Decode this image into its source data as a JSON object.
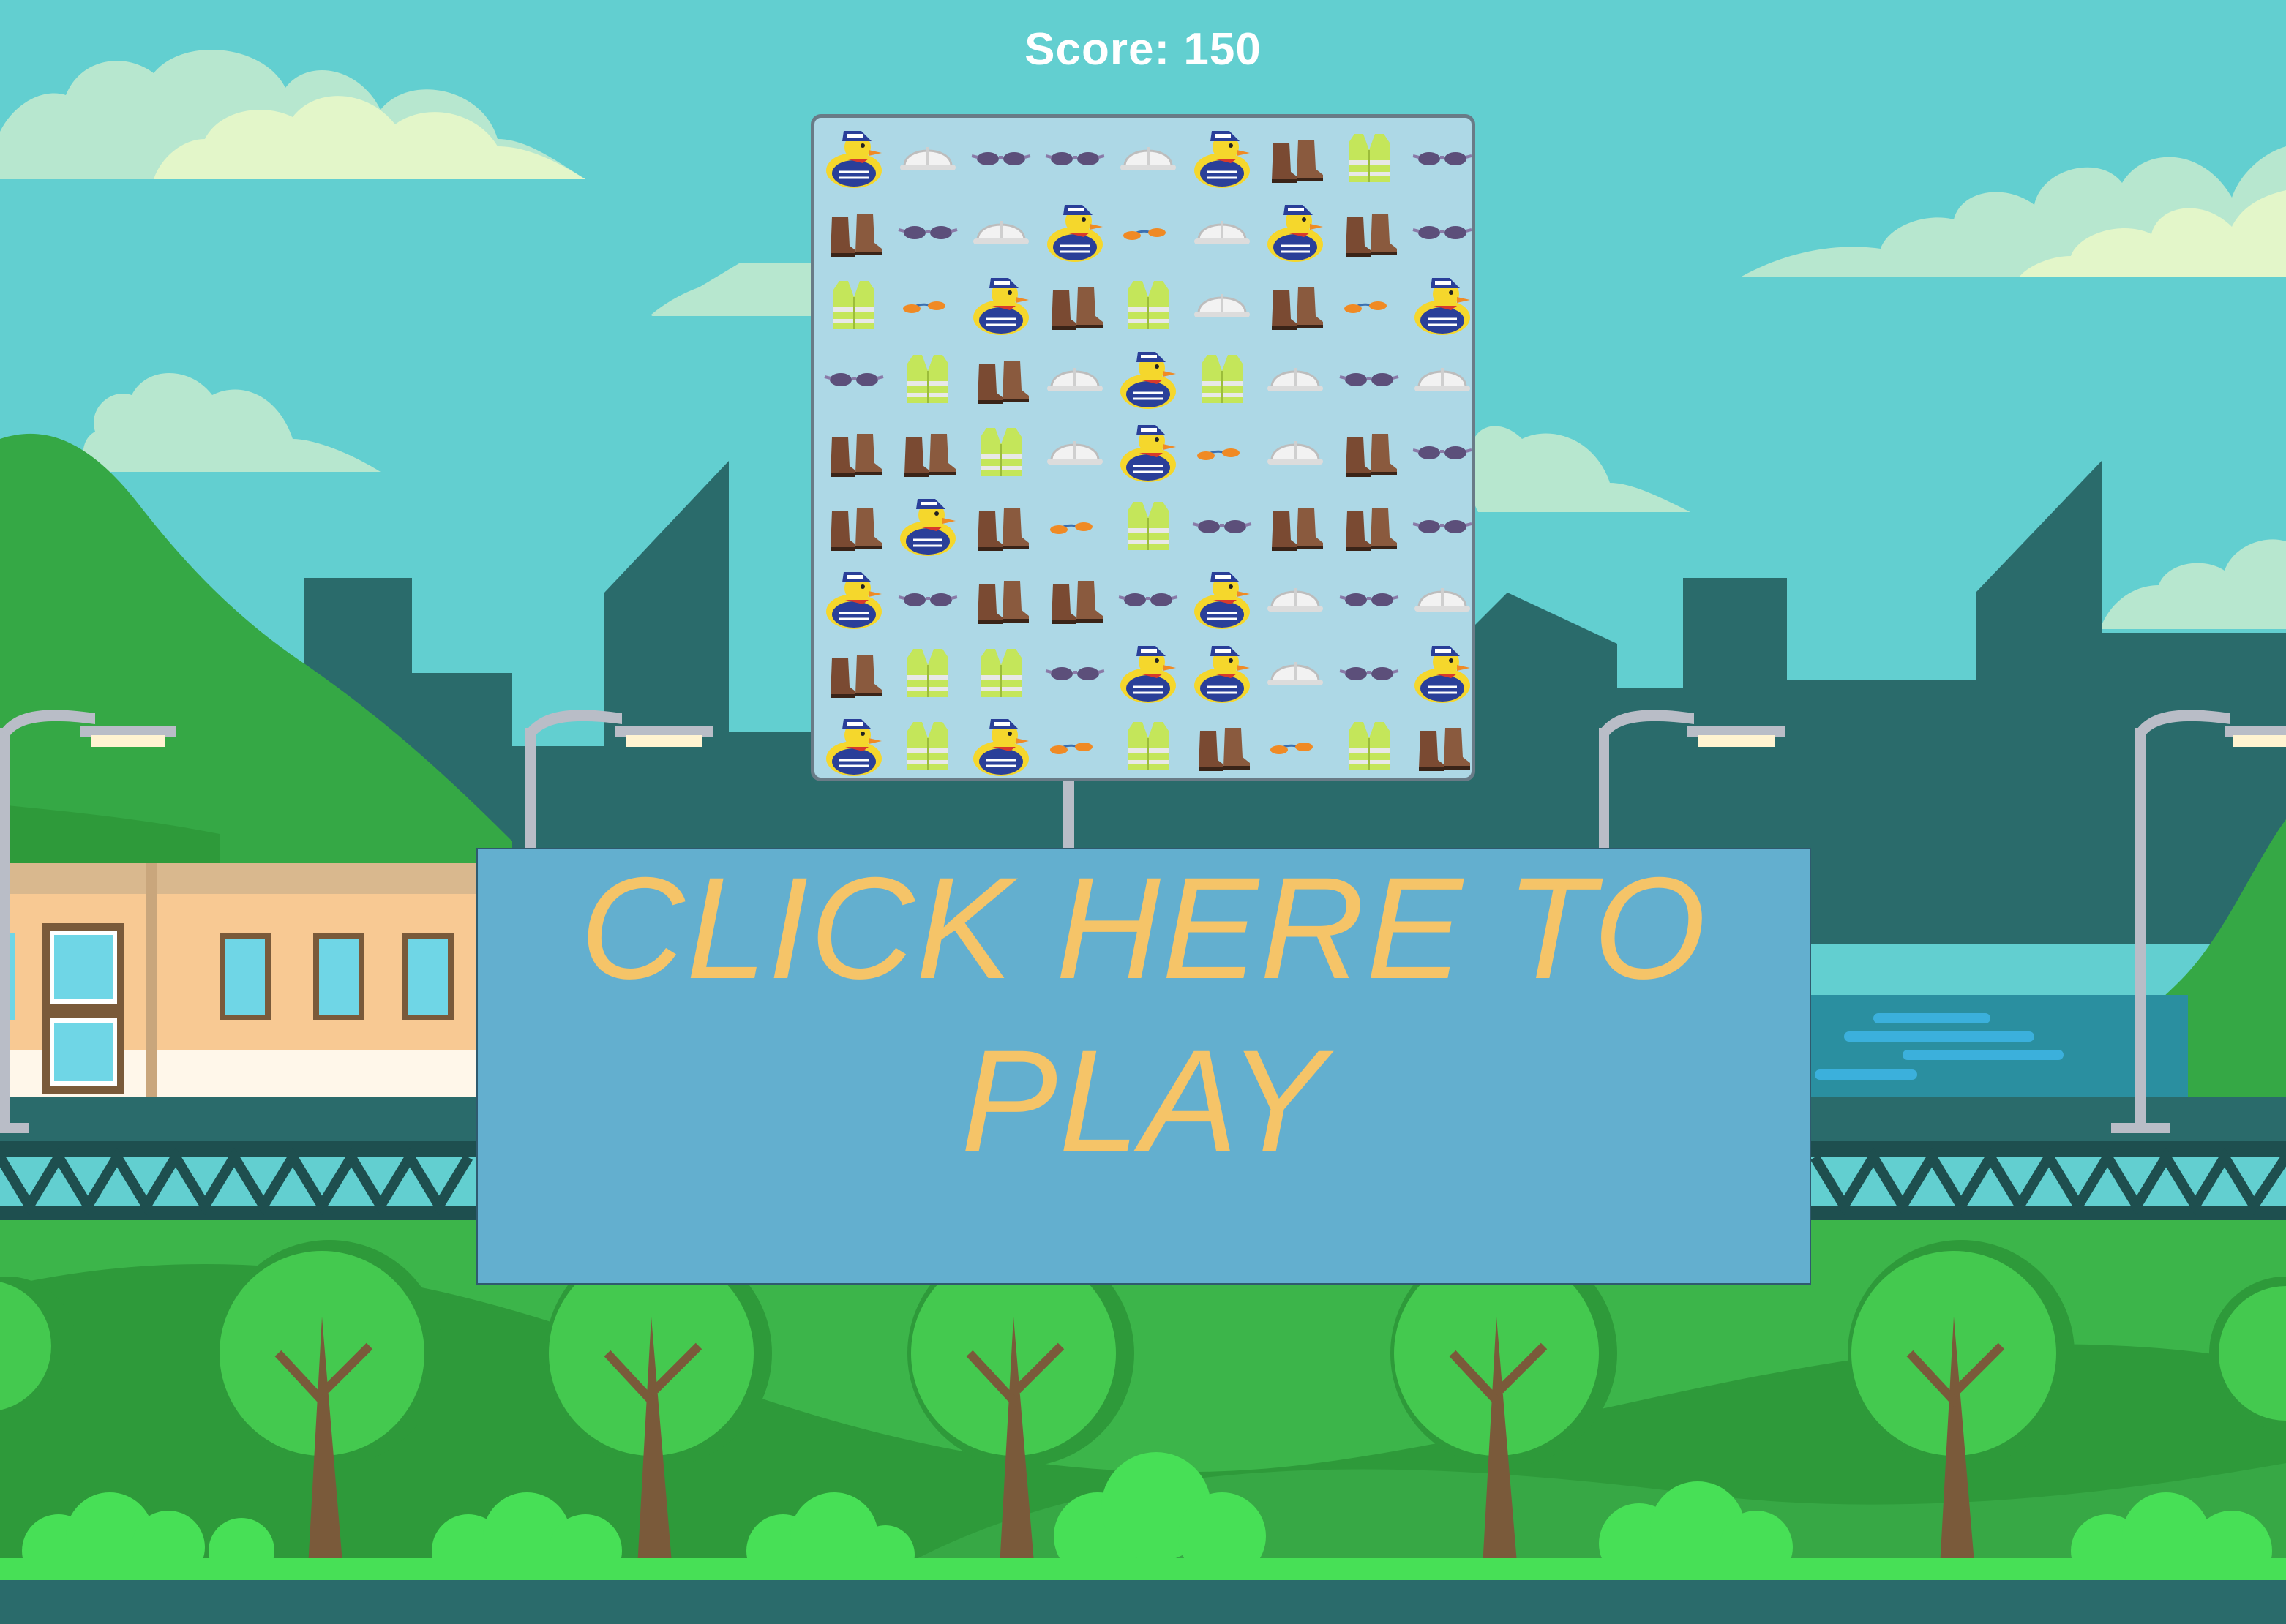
{
  "score": {
    "label": "Score: 150",
    "value": 150
  },
  "play_button": {
    "label": "CLICK HERE TO PLAY"
  },
  "board": {
    "rows": 9,
    "cols": 9,
    "grid": [
      [
        "duck",
        "helmet",
        "glasses",
        "glasses",
        "helmet",
        "duck",
        "boots",
        "vest",
        "glasses"
      ],
      [
        "boots",
        "glasses",
        "helmet",
        "duck",
        "earplugs",
        "helmet",
        "duck",
        "boots",
        "glasses"
      ],
      [
        "vest",
        "earplugs",
        "duck",
        "boots",
        "vest",
        "helmet",
        "boots",
        "earplugs",
        "duck"
      ],
      [
        "glasses",
        "vest",
        "boots",
        "helmet",
        "duck",
        "vest",
        "helmet",
        "glasses",
        "helmet"
      ],
      [
        "boots",
        "boots",
        "vest",
        "helmet",
        "duck",
        "earplugs",
        "helmet",
        "boots",
        "glasses"
      ],
      [
        "boots",
        "duck",
        "boots",
        "earplugs",
        "vest",
        "glasses",
        "boots",
        "boots",
        "glasses"
      ],
      [
        "duck",
        "glasses",
        "boots",
        "boots",
        "glasses",
        "duck",
        "helmet",
        "glasses",
        "helmet"
      ],
      [
        "boots",
        "vest",
        "vest",
        "glasses",
        "duck",
        "duck",
        "helmet",
        "glasses",
        "duck"
      ],
      [
        "duck",
        "vest",
        "duck",
        "earplugs",
        "vest",
        "boots",
        "earplugs",
        "vest",
        "boots"
      ]
    ]
  },
  "icons": [
    "duck-icon",
    "helmet-icon",
    "glasses-icon",
    "boots-icon",
    "vest-icon",
    "earplugs-icon"
  ],
  "colors": {
    "sky": "#62cfd0",
    "board_bg": "#add8e6",
    "board_border": "#697b87",
    "panel_bg": "#63afcf",
    "panel_text": "#f5c468",
    "score_text": "#ffffff",
    "city": "#2a6b6b",
    "grass": "#3cb54a",
    "tree_dark": "#2e9a3a"
  }
}
